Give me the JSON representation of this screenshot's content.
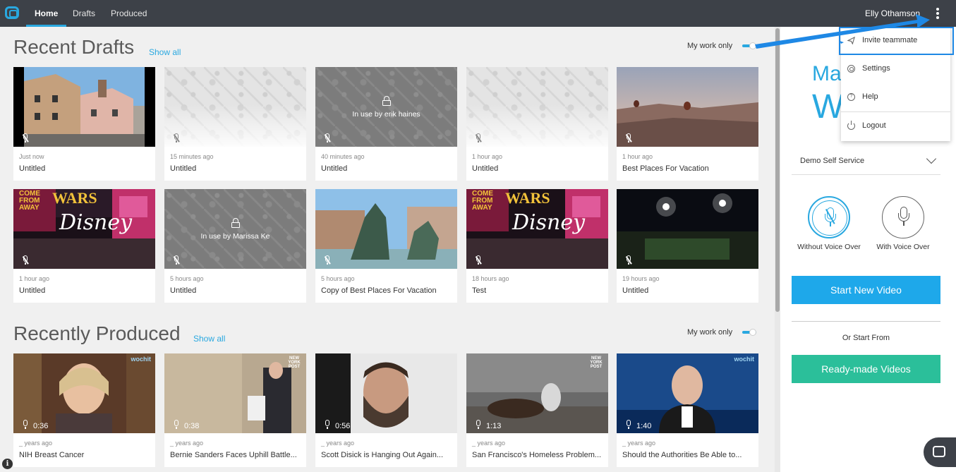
{
  "nav": {
    "tabs": [
      {
        "label": "Home",
        "active": true
      },
      {
        "label": "Drafts",
        "active": false
      },
      {
        "label": "Produced",
        "active": false
      }
    ],
    "user_name": "Elly Othamson"
  },
  "recent_drafts": {
    "title": "Recent Drafts",
    "show_all": "Show all",
    "my_work_only": "My work only",
    "items": [
      {
        "time": "Just now",
        "title": "Untitled",
        "thumb": "town-houses"
      },
      {
        "time": "15 minutes ago",
        "title": "Untitled",
        "thumb": "pattern"
      },
      {
        "time": "40 minutes ago",
        "title": "Untitled",
        "thumb": "pattern-locked",
        "lock_text": "In use by erik haines"
      },
      {
        "time": "1 hour ago",
        "title": "Untitled",
        "thumb": "pattern"
      },
      {
        "time": "1 hour ago",
        "title": "Best Places For Vacation",
        "thumb": "balloons"
      },
      {
        "time": "1 hour ago",
        "title": "Untitled",
        "thumb": "disney"
      },
      {
        "time": "5 hours ago",
        "title": "Untitled",
        "thumb": "pattern-locked",
        "lock_text": "In use by Marissa Ke"
      },
      {
        "time": "5 hours ago",
        "title": "Copy of Best Places For Vacation",
        "thumb": "statue"
      },
      {
        "time": "18 hours ago",
        "title": "Test",
        "thumb": "disney"
      },
      {
        "time": "19 hours ago",
        "title": "Untitled",
        "thumb": "stadium"
      }
    ]
  },
  "recently_produced": {
    "title": "Recently Produced",
    "show_all": "Show all",
    "my_work_only": "My work only",
    "items": [
      {
        "time": "_ years ago",
        "title": "NIH Breast Cancer",
        "duration": "0:36",
        "thumb": "woman",
        "tag": "wochit"
      },
      {
        "time": "_ years ago",
        "title": "Bernie Sanders Faces Uphill Battle...",
        "duration": "0:38",
        "thumb": "bernie",
        "tag": "NEW YORK POST"
      },
      {
        "time": "_ years ago",
        "title": "Scott Disick is Hanging Out Again...",
        "duration": "0:56",
        "thumb": "scott",
        "tag": ""
      },
      {
        "time": "_ years ago",
        "title": "San Francisco's Homeless Problem...",
        "duration": "1:13",
        "thumb": "homeless",
        "tag": "NEW YORK POST"
      },
      {
        "time": "_ years ago",
        "title": "Should the Authorities Be Able to...",
        "duration": "1:40",
        "thumb": "cook",
        "tag": "wochit"
      }
    ]
  },
  "right_panel": {
    "welcome_line1": "Ma",
    "welcome_line2": "W",
    "account": "Demo Self Service",
    "vo_without": "Without Voice Over",
    "vo_with": "With Voice Over",
    "start_new": "Start New Video",
    "or_start_from": "Or Start From",
    "ready_made": "Ready-made Videos"
  },
  "menu": {
    "items": [
      {
        "label": "Invite teammate",
        "icon": "send-icon"
      },
      {
        "label": "Settings",
        "icon": "gear-icon"
      },
      {
        "label": "Help",
        "icon": "help-icon"
      },
      {
        "label": "Logout",
        "icon": "power-icon"
      }
    ]
  },
  "colors": {
    "accent": "#29a8e0",
    "start_button": "#1ea8ea",
    "ready_button": "#2bbf9a",
    "topbar": "#3d4148",
    "highlight": "#1e88e5"
  }
}
